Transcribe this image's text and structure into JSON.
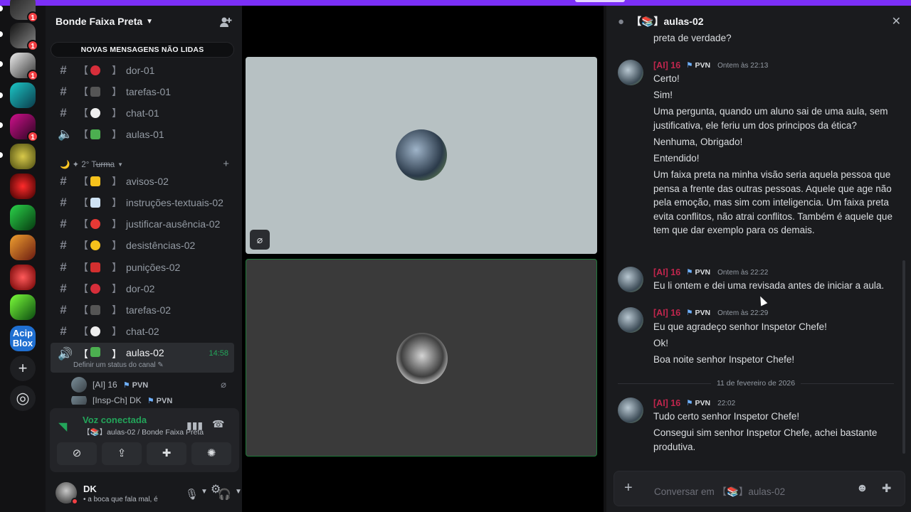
{
  "colors": {
    "accent_bar": "#7b2ff7",
    "voice_green": "#23a55a",
    "author": "#c0264d",
    "badge_red": "#f23f43"
  },
  "servers": [
    {
      "badge": "1"
    },
    {
      "badge": "1"
    },
    {
      "badge": "1"
    },
    {
      "badge": ""
    },
    {
      "badge": "1"
    },
    {
      "badge": ""
    },
    {
      "badge": ""
    },
    {
      "badge": ""
    },
    {
      "badge": ""
    },
    {
      "badge": ""
    },
    {
      "badge": ""
    },
    {
      "label": "Acip\nBlox"
    }
  ],
  "guild": {
    "name": "Bonde Faixa Preta",
    "unread_pill": "NOVAS MENSAGENS NÃO LIDAS"
  },
  "channels_top": [
    {
      "label": "dor-01",
      "icon": "voice"
    },
    {
      "label": "tarefas-01"
    },
    {
      "label": "chat-01"
    },
    {
      "label": "aulas-01"
    }
  ],
  "category": {
    "label": "🌙 ✦ 2° Turma"
  },
  "channels": [
    {
      "label": "avisos-02"
    },
    {
      "label": "instruções-textuais-02"
    },
    {
      "label": "justificar-ausência-02"
    },
    {
      "label": "desistências-02"
    },
    {
      "label": "punições-02"
    },
    {
      "label": "dor-02"
    },
    {
      "label": "tarefas-02"
    },
    {
      "label": "chat-02"
    }
  ],
  "active_channel": {
    "label": "aulas-02",
    "time": "14:58",
    "status_prompt": "Definir um status do canal ✎"
  },
  "voice_users": [
    {
      "name": "[AI] 16",
      "tag": "PVN"
    },
    {
      "name": "[Insp-Ch] DK",
      "tag": "PVN"
    }
  ],
  "voice": {
    "title": "Voz conectada",
    "subtitle": "【📚】aulas-02 / Bonde Faixa Preta"
  },
  "user": {
    "name": "DK",
    "status": "• a boca que fala mal, é"
  },
  "chat": {
    "title": "【📚】aulas-02",
    "top_fragment": "preta de verdade?",
    "messages": [
      {
        "author": "[AI] 16",
        "role": "PVN",
        "time": "Ontem às 22:13",
        "lines": [
          "Certo!",
          "Sim!",
          "Uma pergunta, quando um aluno sai de uma aula, sem justificativa, ele feriu um dos principos da ética?",
          "Nenhuma, Obrigado!",
          "Entendido!",
          "Um faixa preta na minha visão seria aquela pessoa que pensa a frente das outras pessoas. Aquele que age não pela emoção, mas sim com inteligencia. Um faixa preta evita conflitos, não atrai conflitos. Também é aquele que tem que dar exemplo para os demais."
        ]
      },
      {
        "author": "[AI] 16",
        "role": "PVN",
        "time": "Ontem às 22:22",
        "lines": [
          "Eu li ontem e dei uma revisada antes de iniciar a aula."
        ]
      },
      {
        "author": "[AI] 16",
        "role": "PVN",
        "time": "Ontem às 22:29",
        "lines": [
          "Eu que agradeço senhor Inspetor Chefe!",
          "Ok!",
          "Boa noite senhor Inspetor Chefe!"
        ]
      },
      {
        "author": "[AI] 16",
        "role": "PVN",
        "time": "22:02",
        "lines": [
          "Tudo certo senhor Inspetor Chefe!",
          "Consegui sim senhor Inspetor Chefe, achei bastante produtiva."
        ]
      }
    ],
    "date_divider": "11 de fevereiro de 2026",
    "composer_placeholder": "Conversar em 【📚】aulas-02"
  }
}
